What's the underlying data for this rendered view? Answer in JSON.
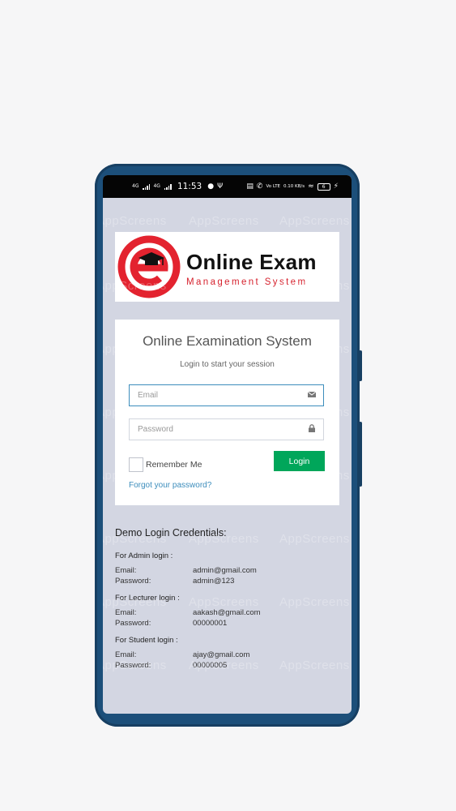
{
  "status_bar": {
    "network_left": "4G",
    "network_left_2": "4G",
    "time": "11:53",
    "volte": "Vo LTE",
    "data_rate": "0.10 KB/s",
    "battery": "6"
  },
  "logo": {
    "title": "Online Exam",
    "subtitle": "Management System"
  },
  "login": {
    "title": "Online Examination System",
    "subtitle": "Login to start your session",
    "email_placeholder": "Email",
    "password_placeholder": "Password",
    "remember_label": "Remember Me",
    "login_button": "Login",
    "forgot_link": "Forgot your password?"
  },
  "demo": {
    "heading": "Demo Login Credentials:",
    "email_label": "Email:",
    "password_label": "Password:",
    "admin": {
      "title": "For Admin login :",
      "email": "admin@gmail.com",
      "password": "admin@123"
    },
    "lecturer": {
      "title": "For Lecturer login :",
      "email": "aakash@gmail.com",
      "password": "00000001"
    },
    "student": {
      "title": "For Student login :",
      "email": "ajay@gmail.com",
      "password": "00000005"
    }
  },
  "watermark": "AppScreens",
  "colors": {
    "accent": "#3c8dbc",
    "login_button": "#00a65a",
    "brand_red": "#d6222e",
    "phone_frame": "#1c4f7a"
  }
}
